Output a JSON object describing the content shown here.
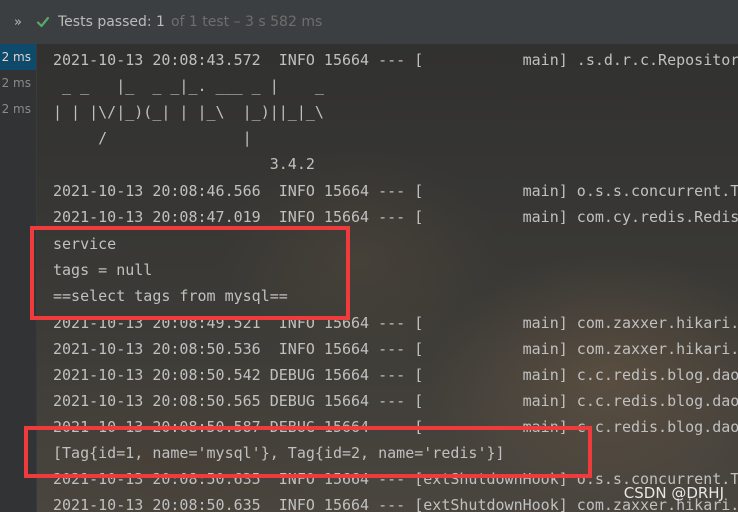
{
  "toolbar": {
    "chevron": "»",
    "check_icon": "check-icon",
    "passed_label": "Tests passed: 1",
    "summary": "of 1 test – 3 s 582 ms"
  },
  "gutter": {
    "times": [
      "2 ms",
      "2 ms",
      "2 ms"
    ]
  },
  "console": {
    "lines": [
      "2021-10-13 20:08:43.572  INFO 15664 --- [           main] .s.d.r.c.RepositoryConfigurationDelegate",
      " _ _   |_  _ _|_. ___ _ |    _",
      "| | |\\/|_)(_| | |_\\  |_)||_|_\\",
      "     /               |",
      "                        3.4.2",
      "2021-10-13 20:08:46.566  INFO 15664 --- [           main] o.s.s.concurrent.ThreadPoolTaskExecutor",
      "2021-10-13 20:08:47.019  INFO 15664 --- [           main] com.cy.redis.RedisTests",
      "service",
      "tags = null",
      "==select tags from mysql==",
      "2021-10-13 20:08:49.521  INFO 15664 --- [           main] com.zaxxer.hikari.HikariDataSource",
      "2021-10-13 20:08:50.536  INFO 15664 --- [           main] com.zaxxer.hikari.HikariDataSource",
      "2021-10-13 20:08:50.542 DEBUG 15664 --- [           main] c.c.redis.blog.dao.TagMapper",
      "2021-10-13 20:08:50.565 DEBUG 15664 --- [           main] c.c.redis.blog.dao.TagMapper",
      "2021-10-13 20:08:50.587 DEBUG 15664 --- [           main] c.c.redis.blog.dao.TagMapper",
      "[Tag{id=1, name='mysql'}, Tag{id=2, name='redis'}]",
      "2021-10-13 20:08:50.635  INFO 15664 --- [extShutdownHook] o.s.s.concurrent.ThreadPoolTaskExecutor",
      "2021-10-13 20:08:50.635  INFO 15664 --- [extShutdownHook] com.zaxxer.hikari.HikariDataSource"
    ]
  },
  "watermark": "CSDN @DRHJ",
  "colors": {
    "highlight_border": "#ef3b3b",
    "check_green": "#59a869"
  }
}
